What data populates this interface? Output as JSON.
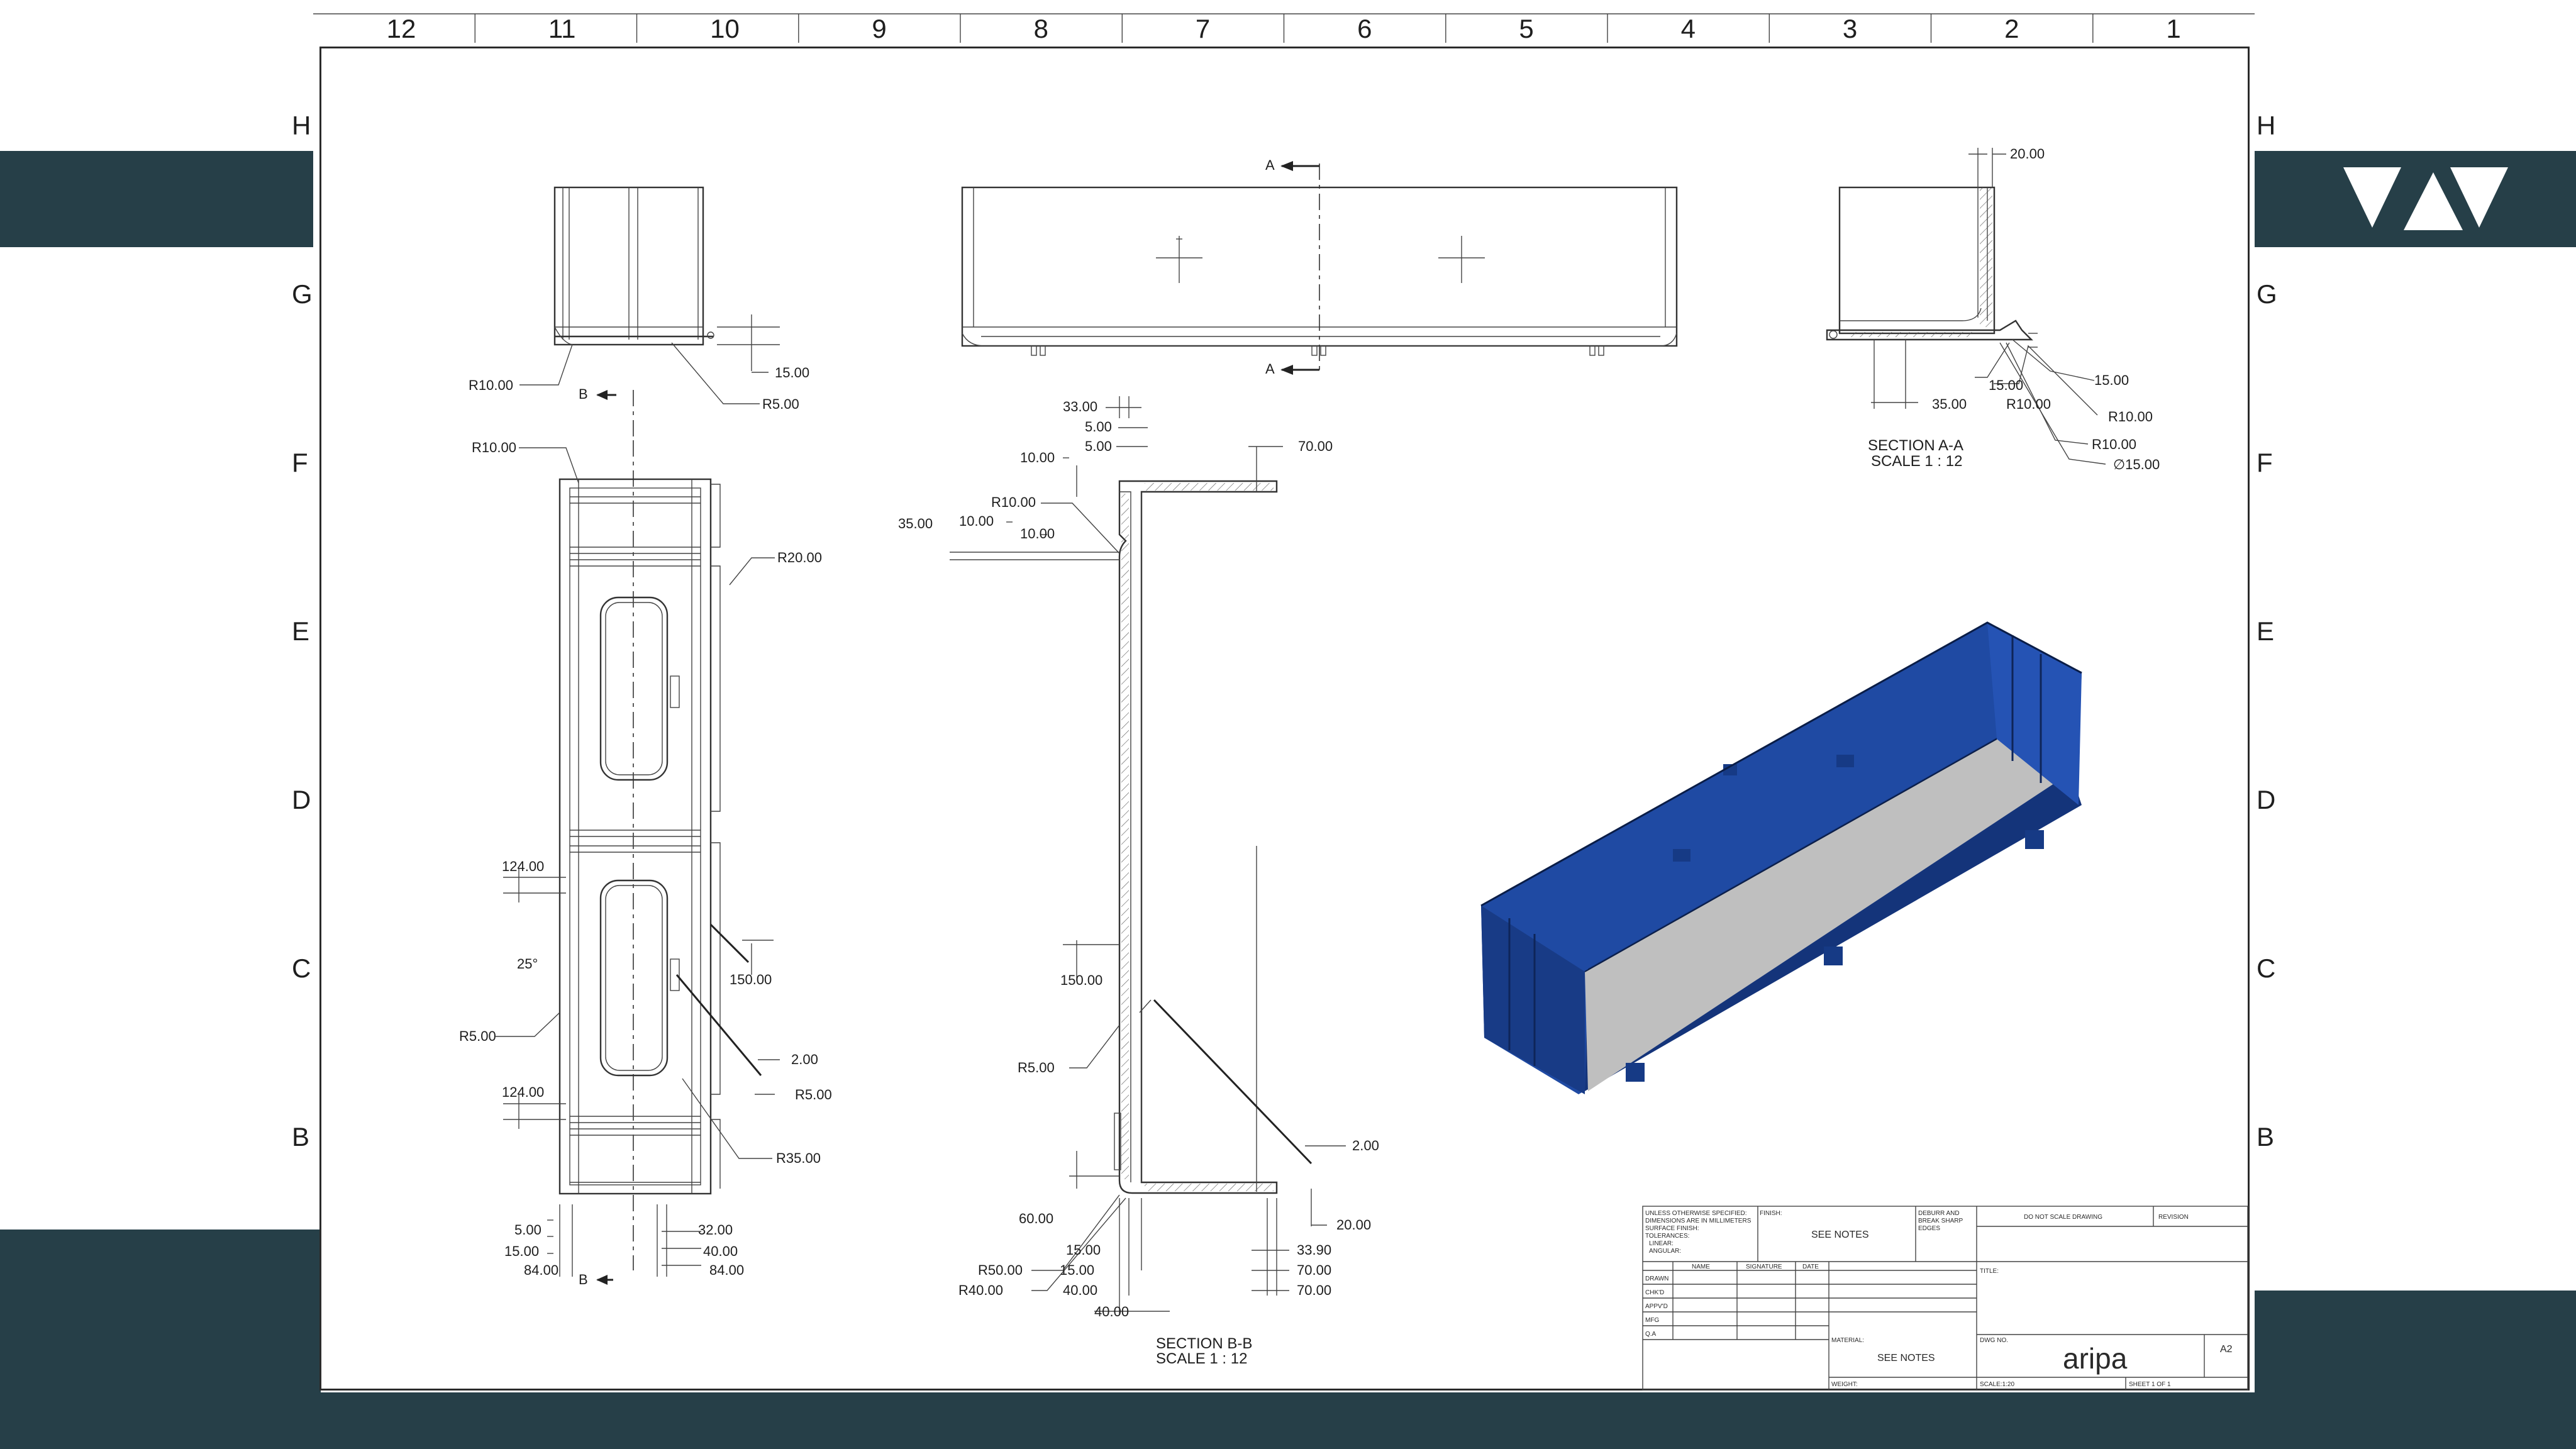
{
  "brand": {
    "background_color": "#263f48",
    "logo_icon": "wedge-logo-icon"
  },
  "zones": {
    "columns": [
      "12",
      "11",
      "10",
      "9",
      "8",
      "7",
      "6",
      "5",
      "4",
      "3",
      "2",
      "1"
    ],
    "rows": [
      "H",
      "G",
      "F",
      "E",
      "D",
      "C",
      "B"
    ]
  },
  "views": {
    "top_view": {
      "dims": [
        "R10.00",
        "R5.00",
        "15.00"
      ],
      "cut_label": "B"
    },
    "front_view": {
      "cut_label": "A"
    },
    "section_b_view": {
      "dims": [
        "R10.00",
        "R20.00",
        "124.00",
        "25°",
        "R5.00",
        "150.00",
        "2.00",
        "R5.00",
        "124.00",
        "R35.00",
        "5.00",
        "15.00",
        "84.00",
        "32.00",
        "40.00",
        "84.00"
      ],
      "cut_label": "B"
    },
    "section_bb": {
      "title": "SECTION B-B",
      "scale": "SCALE 1 : 12",
      "dims": [
        "33.00",
        "5.00",
        "5.00",
        "70.00",
        "10.00",
        "R10.00",
        "35.00",
        "10.00",
        "10.00",
        "150.00",
        "R5.00",
        "2.00",
        "60.00",
        "20.00",
        "15.00",
        "R50.00",
        "15.00",
        "R40.00",
        "40.00",
        "40.00",
        "33.90",
        "70.00",
        "70.00"
      ]
    },
    "section_aa": {
      "title": "SECTION A-A",
      "scale": "SCALE 1 : 12",
      "dims": [
        "20.00",
        "15.00",
        "15.00",
        "35.00",
        "R10.00",
        "R10.00",
        "R10.00",
        "∅15.00"
      ]
    },
    "iso_view": {
      "color": "#1f4aa3",
      "floor_color": "#b9b9b9"
    }
  },
  "title_block": {
    "tolerance_notes": [
      "UNLESS OTHERWISE SPECIFIED:",
      "DIMENSIONS ARE IN MILLIMETERS",
      "SURFACE FINISH:",
      "TOLERANCES:",
      "LINEAR:",
      "ANGULAR:"
    ],
    "finish_label": "FINISH:",
    "finish_value": "SEE NOTES",
    "deburr_note": [
      "DEBURR AND",
      "BREAK SHARP",
      "EDGES"
    ],
    "do_not_scale": "DO NOT SCALE DRAWING",
    "revision_label": "REVISION",
    "headers": [
      "NAME",
      "SIGNATURE",
      "DATE"
    ],
    "title_label": "TITLE:",
    "roles": [
      "DRAWN",
      "CHK'D",
      "APPV'D",
      "MFG",
      "Q.A"
    ],
    "material_label": "MATERIAL:",
    "material_value": "SEE NOTES",
    "dwg_no_label": "DWG NO.",
    "dwg_no_value": "aripa",
    "size": "A2",
    "weight_label": "WEIGHT:",
    "scale_label": "SCALE:1:20",
    "sheet_label": "SHEET 1 OF 1"
  }
}
